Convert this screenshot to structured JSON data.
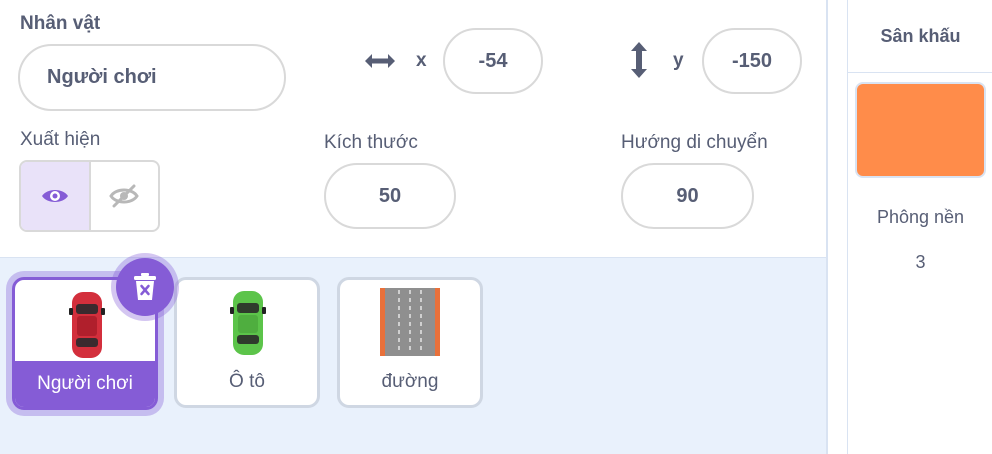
{
  "sprite_info": {
    "sprite_label": "Nhân vật",
    "sprite_name": "Người chơi",
    "x_label": "x",
    "x_value": "-54",
    "y_label": "y",
    "y_value": "-150",
    "show_label": "Xuất hiện",
    "show_state": "visible",
    "size_label": "Kích thước",
    "size_value": "50",
    "direction_label": "Hướng di chuyển",
    "direction_value": "90"
  },
  "sprites": [
    {
      "name": "Người chơi",
      "selected": true,
      "icon": "red-car"
    },
    {
      "name": "Ô tô",
      "selected": false,
      "icon": "green-car"
    },
    {
      "name": "đường",
      "selected": false,
      "icon": "road"
    }
  ],
  "stage": {
    "title": "Sân khấu",
    "backdrop_label": "Phông nền",
    "backdrop_count": "3",
    "thumbnail_color": "#ff8c4a"
  },
  "colors": {
    "accent": "#855cd6",
    "text": "#575e75",
    "panel_bg": "#e9f1fc"
  }
}
